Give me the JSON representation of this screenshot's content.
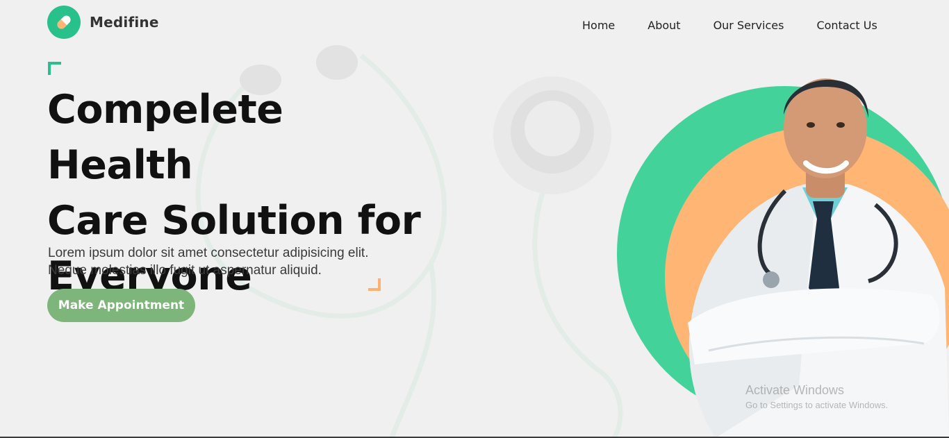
{
  "brand": {
    "name": "Medifine",
    "accent": "#28c08b",
    "logo_icon": "pill-icon"
  },
  "nav": {
    "items": [
      "Home",
      "About",
      "Our Services",
      "Contact Us"
    ]
  },
  "hero": {
    "title_lines": [
      "Compelete Health",
      "Care Solution for",
      "Everyone"
    ],
    "description_lines": [
      "Lorem ipsum dolor sit amet consectetur adipisicing elit.",
      "Neque molestias illo fugit ut aspernatur aliquid."
    ],
    "cta_label": "Make Appointment",
    "cta_color": "#7eb57a"
  },
  "illustration": {
    "subject": "doctor-image",
    "circle_colors": {
      "outer": "#43d39a",
      "inner": "#ffb574"
    }
  },
  "watermark": {
    "title": "Activate Windows",
    "subtitle": "Go to Settings to activate Windows."
  }
}
